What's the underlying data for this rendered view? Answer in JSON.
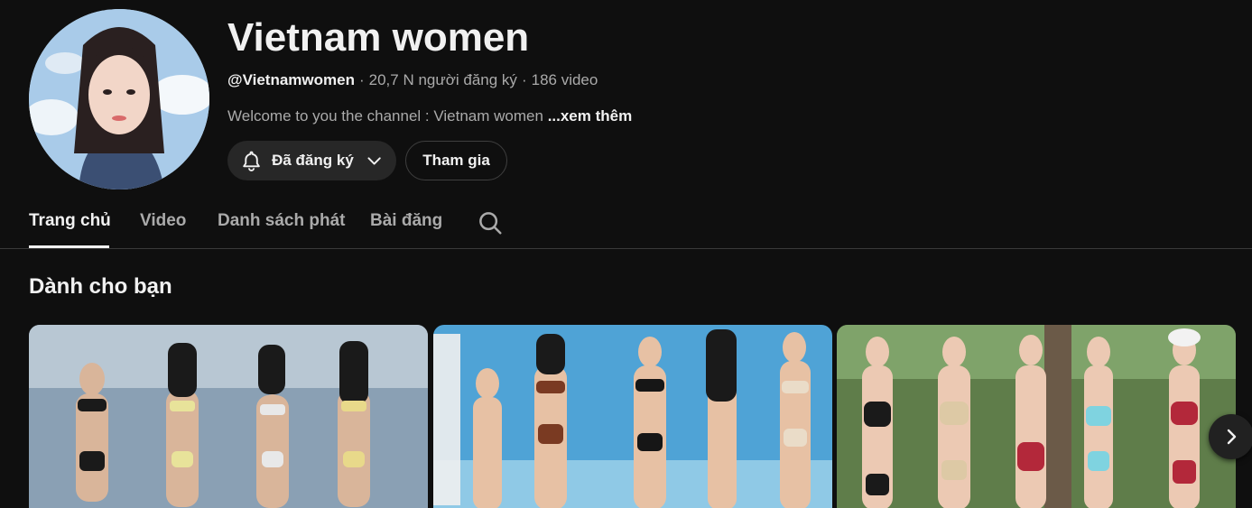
{
  "channel": {
    "title": "Vietnam women",
    "handle": "@Vietnamwomen",
    "subscribers": "20,7 N người đăng ký",
    "video_count": "186 video",
    "separator": "·",
    "description": "Welcome to you the channel : Vietnam women",
    "more_label": "...xem thêm",
    "avatar_icon": "channel-avatar"
  },
  "actions": {
    "subscribed_label": "Đã đăng ký",
    "subscribed_icon": "bell-icon",
    "dropdown_icon": "chevron-down-icon",
    "join_label": "Tham gia"
  },
  "tabs": {
    "items": [
      {
        "label": "Trang chủ",
        "active": true
      },
      {
        "label": "Video",
        "active": false
      },
      {
        "label": "Danh sách phát",
        "active": false
      },
      {
        "label": "Bài đăng",
        "active": false
      }
    ],
    "search_icon": "search-icon"
  },
  "section": {
    "title": "Dành cho bạn"
  },
  "carousel": {
    "next_icon": "chevron-right-icon"
  },
  "colors": {
    "background": "#0f0f0f",
    "text_primary": "#f1f1f1",
    "text_secondary": "#aaaaaa",
    "button_bg": "#272727"
  }
}
